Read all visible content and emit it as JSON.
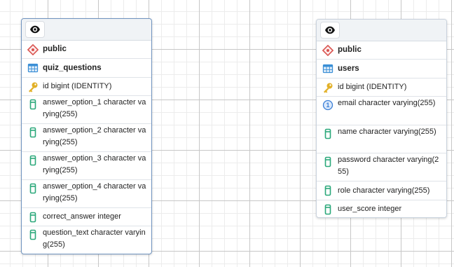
{
  "tables": [
    {
      "schema": "public",
      "name": "quiz_questions",
      "columns": [
        {
          "text": "id bigint (IDENTITY)",
          "icon": "key-icon"
        },
        {
          "text": "answer_option_1 character varying(255)",
          "icon": "column-icon"
        },
        {
          "text": "answer_option_2 character varying(255)",
          "icon": "column-icon"
        },
        {
          "text": "answer_option_3 character varying(255)",
          "icon": "column-icon"
        },
        {
          "text": "answer_option_4 character varying(255)",
          "icon": "column-icon"
        },
        {
          "text": "correct_answer integer",
          "icon": "column-icon"
        },
        {
          "text": "question_text character varying(255)",
          "icon": "column-icon"
        }
      ]
    },
    {
      "schema": "public",
      "name": "users",
      "columns": [
        {
          "text": "id bigint (IDENTITY)",
          "icon": "key-icon"
        },
        {
          "text": "email character varying(255)",
          "icon": "unique-constraint-icon",
          "badge": "1"
        },
        {
          "text": "name character varying(255)",
          "icon": "column-icon"
        },
        {
          "text": "password character varying(255)",
          "icon": "column-icon"
        },
        {
          "text": "role character varying(255)",
          "icon": "column-icon"
        },
        {
          "text": "user_score integer",
          "icon": "column-icon"
        }
      ]
    }
  ],
  "colors": {
    "schema_icon": "#d9534f",
    "table_icon": "#3b8fd6",
    "key_icon": "#e2b027",
    "column_icon": "#2aa87a",
    "unique_icon": "#3b7fd6",
    "selected_border": "#6f93bf"
  }
}
